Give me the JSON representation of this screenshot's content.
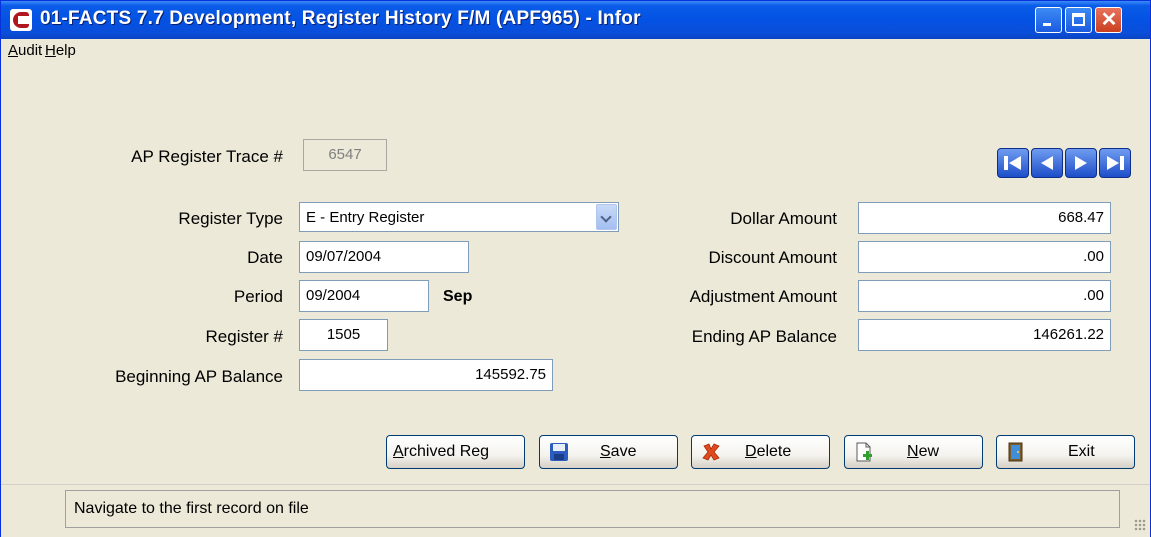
{
  "window": {
    "title": "01-FACTS 7.7 Development, Register History F/M (APF965) - Infor"
  },
  "titlebar_buttons": {
    "close": "✕"
  },
  "menu": {
    "audit": "Audit",
    "help": "Help"
  },
  "form": {
    "trace_label": "AP Register Trace #",
    "trace_value": "6547",
    "register_type_label": "Register Type",
    "register_type_value": "E - Entry Register",
    "date_label": "Date",
    "date_value": "09/07/2004",
    "period_label": "Period",
    "period_value": "09/2004",
    "period_month": "Sep",
    "register_no_label": "Register #",
    "register_no_value": "1505",
    "beginning_label": "Beginning AP Balance",
    "beginning_value": "145592.75",
    "dollar_label": "Dollar Amount",
    "dollar_value": "668.47",
    "discount_label": "Discount Amount",
    "discount_value": ".00",
    "adjustment_label": "Adjustment Amount",
    "adjustment_value": ".00",
    "ending_label": "Ending AP Balance",
    "ending_value": "146261.22"
  },
  "nav": {
    "icons": [
      "nav-first-icon",
      "nav-prev-icon",
      "nav-next-icon",
      "nav-last-icon"
    ]
  },
  "buttons": {
    "archived": "Archived Reg",
    "save": "Save",
    "delete": "Delete",
    "new": "New",
    "exit": "Exit"
  },
  "status": {
    "text": "Navigate to the first record on file"
  },
  "colors": {
    "titlebar": "#0452E3",
    "face": "#ECE9D8",
    "field_border": "#7F9DB9",
    "close": "#C9401F"
  }
}
